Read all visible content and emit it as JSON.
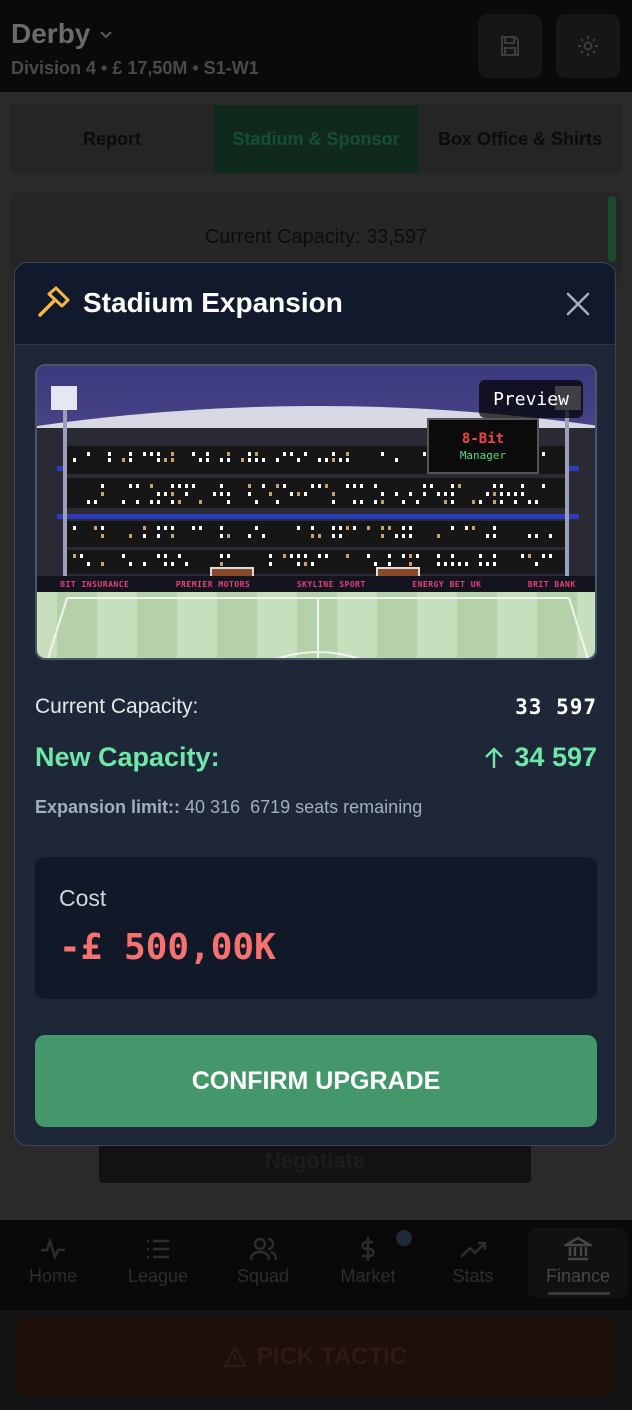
{
  "header": {
    "club_name": "Derby",
    "subtitle": "Division 4 • £ 17,50M • S1-W1",
    "save_icon": "save-icon",
    "settings_icon": "gear-icon"
  },
  "tabs": [
    {
      "label": "Report"
    },
    {
      "label": "Stadium & Sponsor",
      "active": true
    },
    {
      "label": "Box Office & Shirts"
    }
  ],
  "background": {
    "capacity_text": "Current Capacity: 33,597",
    "negotiate_label": "Negotiate"
  },
  "bottom_nav": [
    {
      "label": "Home",
      "icon": "activity-icon"
    },
    {
      "label": "League",
      "icon": "list-icon"
    },
    {
      "label": "Squad",
      "icon": "users-icon"
    },
    {
      "label": "Market",
      "icon": "dollar-icon"
    },
    {
      "label": "Stats",
      "icon": "trending-up-icon"
    },
    {
      "label": "Finance",
      "icon": "bank-icon",
      "active": true
    }
  ],
  "pick_tactic_label": "PICK TACTIC",
  "modal": {
    "title": "Stadium Expansion",
    "icon": "hammer-icon",
    "preview_label": "Preview",
    "scoreboard_title": "8-Bit",
    "scoreboard_sub": "Manager",
    "ad_boards": [
      "BIT INSURANCE",
      "PREMIER MOTORS",
      "SKYLINE SPORT",
      "ENERGY BET UK",
      "BRIT BANK"
    ],
    "current_capacity_label": "Current Capacity:",
    "current_capacity_value": "33 597",
    "new_capacity_label": "New Capacity:",
    "new_capacity_value": "34 597",
    "limit_label": "Expansion limit::",
    "limit_value": "40 316",
    "seats_remaining": "6719 seats remaining",
    "cost_label": "Cost",
    "cost_value": "-£ 500,00K",
    "confirm_label": "CONFIRM UPGRADE"
  },
  "colors": {
    "modal_bg": "#1e2738",
    "accent_green": "#6ee7a8",
    "confirm_bg": "#44976a",
    "cost_red": "#f87171"
  }
}
